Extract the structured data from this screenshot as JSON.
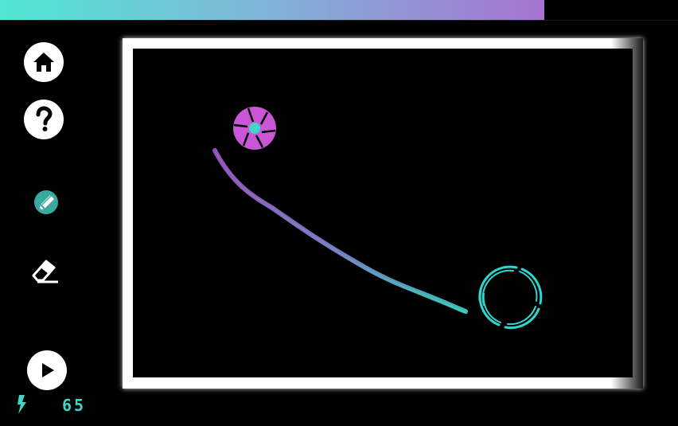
{
  "level_progress": {
    "fraction": 0.803,
    "gradient": [
      "#4fe6d4",
      "#a573d0"
    ]
  },
  "sidebar": {
    "home_icon": "home-icon",
    "help_icon": "question-icon",
    "pencil_tool": {
      "icon": "pencil-icon",
      "selected": true,
      "color": "#3aa89e"
    },
    "eraser_tool": {
      "icon": "eraser-icon",
      "selected": false
    },
    "play_icon": "play-icon"
  },
  "energy": {
    "icon": "lightning-icon",
    "value": "65",
    "color": "#3fd6c8"
  },
  "board": {
    "ball": {
      "color": "#c956d6",
      "core_color": "#3fd6c8",
      "icon": "aperture-ball"
    },
    "drawn_line": {
      "gradient": [
        "#a05ac4",
        "#3fd6c8"
      ]
    },
    "portal": {
      "color": "#2fd6d0",
      "icon": "swirl-portal"
    }
  }
}
